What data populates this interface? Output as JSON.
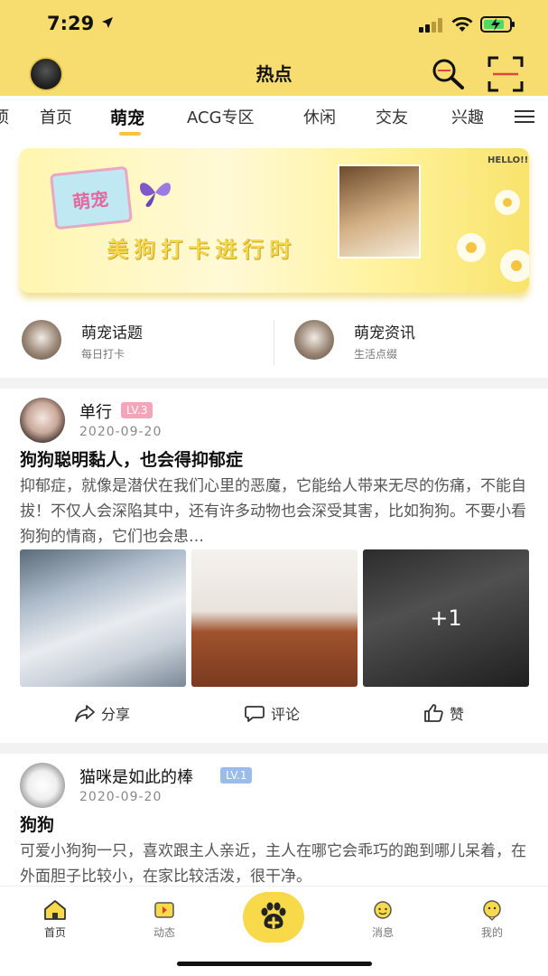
{
  "status_bar": {
    "time": "7:29"
  },
  "header": {
    "title": "热点"
  },
  "tabs": [
    {
      "label": "项"
    },
    {
      "label": "首页"
    },
    {
      "label": "萌宠",
      "active": true
    },
    {
      "label": "ACG专区"
    },
    {
      "label": "休闲"
    },
    {
      "label": "交友"
    },
    {
      "label": "兴趣"
    }
  ],
  "banner": {
    "tag": "萌宠",
    "slogan": "美狗打卡进行时",
    "hello": "HELLO!!"
  },
  "categories": [
    {
      "title": "萌宠话题",
      "sub": "每日打卡"
    },
    {
      "title": "萌宠资讯",
      "sub": "生活点缀"
    }
  ],
  "posts": [
    {
      "author": "单行",
      "level": "LV.3",
      "date": "2020-09-20",
      "title": "狗狗聪明黏人，也会得抑郁症",
      "body": "抑郁症，就像是潜伏在我们心里的恶魔，它能给人带来无尽的伤痛，不能自拔！不仅人会深陷其中，还有许多动物也会深受其害，比如狗狗。不要小看狗狗的情商，它们也会患…",
      "more_images": "+1",
      "actions": {
        "share": "分享",
        "comment": "评论",
        "like": "赞"
      }
    },
    {
      "author": "猫咪是如此的棒",
      "level": "LV.1",
      "date": "2020-09-20",
      "title": "狗狗",
      "body": "可爱小狗狗一只，喜欢跟主人亲近，主人在哪它会乖巧的跑到哪儿呆着，在外面胆子比较小，在家比较活泼，很干净。"
    }
  ],
  "bottom_nav": [
    {
      "label": "首页",
      "icon": "home-icon",
      "active": true
    },
    {
      "label": "动态",
      "icon": "video-icon"
    },
    {
      "label": "",
      "icon": "paw-plus-icon"
    },
    {
      "label": "消息",
      "icon": "message-icon"
    },
    {
      "label": "我的",
      "icon": "profile-icon"
    }
  ],
  "colors": {
    "accent": "#f7dc6f",
    "fab": "#f7d94a",
    "level3": "#f3a6b9",
    "level1": "#9bbcea"
  }
}
